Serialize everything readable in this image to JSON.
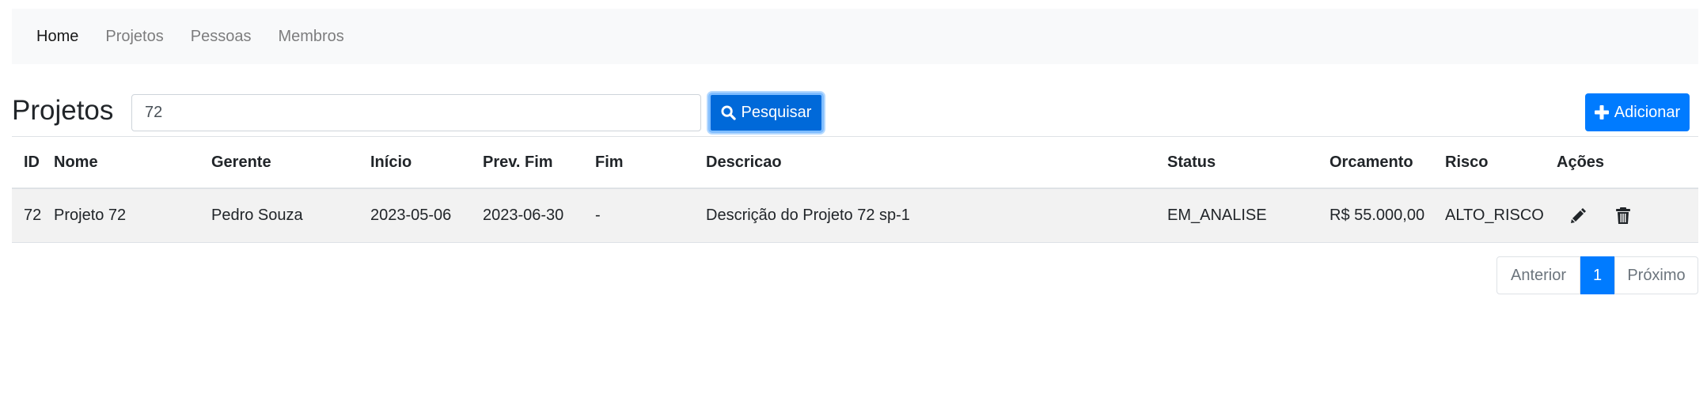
{
  "nav": {
    "items": [
      {
        "label": "Home",
        "active": true
      },
      {
        "label": "Projetos",
        "active": false
      },
      {
        "label": "Pessoas",
        "active": false
      },
      {
        "label": "Membros",
        "active": false
      }
    ]
  },
  "header": {
    "title": "Projetos",
    "search_value": "72",
    "search_button_label": "Pesquisar",
    "add_button_label": "Adicionar"
  },
  "table": {
    "columns": [
      "ID",
      "Nome",
      "Gerente",
      "Início",
      "Prev. Fim",
      "Fim",
      "Descricao",
      "Status",
      "Orcamento",
      "Risco",
      "Ações"
    ],
    "rows": [
      {
        "id": "72",
        "nome": "Projeto 72",
        "gerente": "Pedro Souza",
        "inicio": "2023-05-06",
        "prev_fim": "2023-06-30",
        "fim": "-",
        "descricao": "Descrição do Projeto 72 sp-1",
        "status": "EM_ANALISE",
        "orcamento": "R$ 55.000,00",
        "risco": "ALTO_RISCO",
        "actions": [
          "pencil-icon",
          "trash-icon"
        ]
      }
    ]
  },
  "pagination": {
    "prev_label": "Anterior",
    "current_page": "1",
    "next_label": "Próximo"
  },
  "colors": {
    "primary": "#007bff",
    "navbar_bg": "#f8f9fa",
    "row_bg": "#f2f2f2"
  }
}
